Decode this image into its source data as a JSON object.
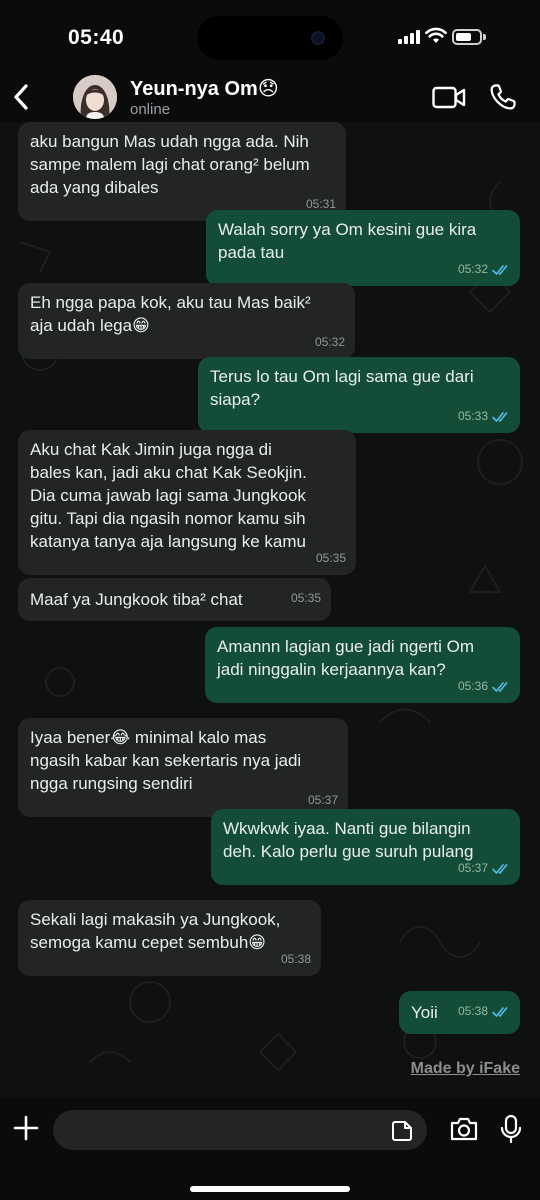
{
  "status_bar": {
    "time": "05:40",
    "battery_fraction": 0.7
  },
  "header": {
    "contact_name": "Yeun-nya Om😞",
    "contact_status": "online",
    "icons": [
      "back-chevron-icon",
      "video-call-icon",
      "phone-icon"
    ]
  },
  "messages": [
    {
      "dir": "in",
      "text": "aku bangun Mas udah ngga ada. Nih\nsampe malem lagi chat orang² belum\nada yang dibales",
      "time": "05:31"
    },
    {
      "dir": "out",
      "text": "Walah sorry ya Om kesini gue kira\npada tau",
      "time": "05:32",
      "read": true
    },
    {
      "dir": "in",
      "text": "Eh ngga papa kok, aku tau Mas baik²\naja udah lega😁",
      "time": "05:32"
    },
    {
      "dir": "out",
      "text": "Terus lo tau Om lagi sama gue dari\nsiapa?",
      "time": "05:33",
      "read": true
    },
    {
      "dir": "in",
      "text": "Aku chat Kak Jimin juga ngga di\nbales kan, jadi aku chat Kak Seokjin.\nDia cuma jawab lagi sama Jungkook\ngitu. Tapi dia ngasih nomor kamu sih\nkatanya tanya aja langsung ke kamu",
      "time": "05:35"
    },
    {
      "dir": "in",
      "text": "Maaf ya Jungkook tiba² chat",
      "time": "05:35"
    },
    {
      "dir": "out",
      "text": "Amannn lagian gue jadi ngerti Om\njadi ninggalin kerjaannya kan?",
      "time": "05:36",
      "read": true
    },
    {
      "dir": "in",
      "text": "Iyaa bener😂 minimal kalo mas\nngasih kabar kan sekertaris nya jadi\nngga rungsing sendiri",
      "time": "05:37"
    },
    {
      "dir": "out",
      "text": "Wkwkwk iyaa. Nanti gue bilangin\ndeh. Kalo perlu gue suruh pulang",
      "time": "05:37",
      "read": true
    },
    {
      "dir": "in",
      "text": "Sekali lagi makasih ya Jungkook,\nsemoga kamu cepet sembuh😁",
      "time": "05:38"
    },
    {
      "dir": "out",
      "text": "Yoii",
      "time": "05:38",
      "read": true
    }
  ],
  "watermark": "Made by iFake",
  "input": {
    "placeholder": "",
    "icons": [
      "plus-icon",
      "sticker-icon",
      "camera-icon",
      "mic-icon"
    ]
  },
  "colors": {
    "incoming_bubble": "#222524",
    "outgoing_bubble": "#144d37",
    "read_tick": "#53bdeb"
  }
}
